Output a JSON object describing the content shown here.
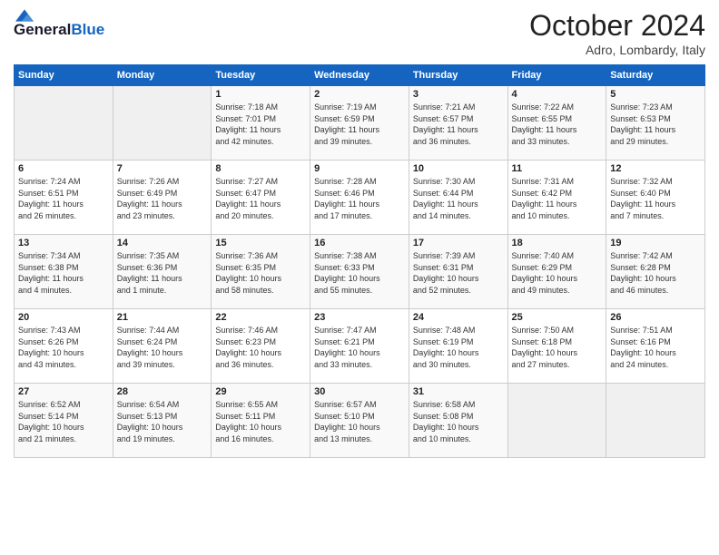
{
  "logo": {
    "general": "General",
    "blue": "Blue"
  },
  "header": {
    "month": "October 2024",
    "location": "Adro, Lombardy, Italy"
  },
  "days_of_week": [
    "Sunday",
    "Monday",
    "Tuesday",
    "Wednesday",
    "Thursday",
    "Friday",
    "Saturday"
  ],
  "weeks": [
    [
      {
        "day": "",
        "info": ""
      },
      {
        "day": "",
        "info": ""
      },
      {
        "day": "1",
        "info": "Sunrise: 7:18 AM\nSunset: 7:01 PM\nDaylight: 11 hours\nand 42 minutes."
      },
      {
        "day": "2",
        "info": "Sunrise: 7:19 AM\nSunset: 6:59 PM\nDaylight: 11 hours\nand 39 minutes."
      },
      {
        "day": "3",
        "info": "Sunrise: 7:21 AM\nSunset: 6:57 PM\nDaylight: 11 hours\nand 36 minutes."
      },
      {
        "day": "4",
        "info": "Sunrise: 7:22 AM\nSunset: 6:55 PM\nDaylight: 11 hours\nand 33 minutes."
      },
      {
        "day": "5",
        "info": "Sunrise: 7:23 AM\nSunset: 6:53 PM\nDaylight: 11 hours\nand 29 minutes."
      }
    ],
    [
      {
        "day": "6",
        "info": "Sunrise: 7:24 AM\nSunset: 6:51 PM\nDaylight: 11 hours\nand 26 minutes."
      },
      {
        "day": "7",
        "info": "Sunrise: 7:26 AM\nSunset: 6:49 PM\nDaylight: 11 hours\nand 23 minutes."
      },
      {
        "day": "8",
        "info": "Sunrise: 7:27 AM\nSunset: 6:47 PM\nDaylight: 11 hours\nand 20 minutes."
      },
      {
        "day": "9",
        "info": "Sunrise: 7:28 AM\nSunset: 6:46 PM\nDaylight: 11 hours\nand 17 minutes."
      },
      {
        "day": "10",
        "info": "Sunrise: 7:30 AM\nSunset: 6:44 PM\nDaylight: 11 hours\nand 14 minutes."
      },
      {
        "day": "11",
        "info": "Sunrise: 7:31 AM\nSunset: 6:42 PM\nDaylight: 11 hours\nand 10 minutes."
      },
      {
        "day": "12",
        "info": "Sunrise: 7:32 AM\nSunset: 6:40 PM\nDaylight: 11 hours\nand 7 minutes."
      }
    ],
    [
      {
        "day": "13",
        "info": "Sunrise: 7:34 AM\nSunset: 6:38 PM\nDaylight: 11 hours\nand 4 minutes."
      },
      {
        "day": "14",
        "info": "Sunrise: 7:35 AM\nSunset: 6:36 PM\nDaylight: 11 hours\nand 1 minute."
      },
      {
        "day": "15",
        "info": "Sunrise: 7:36 AM\nSunset: 6:35 PM\nDaylight: 10 hours\nand 58 minutes."
      },
      {
        "day": "16",
        "info": "Sunrise: 7:38 AM\nSunset: 6:33 PM\nDaylight: 10 hours\nand 55 minutes."
      },
      {
        "day": "17",
        "info": "Sunrise: 7:39 AM\nSunset: 6:31 PM\nDaylight: 10 hours\nand 52 minutes."
      },
      {
        "day": "18",
        "info": "Sunrise: 7:40 AM\nSunset: 6:29 PM\nDaylight: 10 hours\nand 49 minutes."
      },
      {
        "day": "19",
        "info": "Sunrise: 7:42 AM\nSunset: 6:28 PM\nDaylight: 10 hours\nand 46 minutes."
      }
    ],
    [
      {
        "day": "20",
        "info": "Sunrise: 7:43 AM\nSunset: 6:26 PM\nDaylight: 10 hours\nand 43 minutes."
      },
      {
        "day": "21",
        "info": "Sunrise: 7:44 AM\nSunset: 6:24 PM\nDaylight: 10 hours\nand 39 minutes."
      },
      {
        "day": "22",
        "info": "Sunrise: 7:46 AM\nSunset: 6:23 PM\nDaylight: 10 hours\nand 36 minutes."
      },
      {
        "day": "23",
        "info": "Sunrise: 7:47 AM\nSunset: 6:21 PM\nDaylight: 10 hours\nand 33 minutes."
      },
      {
        "day": "24",
        "info": "Sunrise: 7:48 AM\nSunset: 6:19 PM\nDaylight: 10 hours\nand 30 minutes."
      },
      {
        "day": "25",
        "info": "Sunrise: 7:50 AM\nSunset: 6:18 PM\nDaylight: 10 hours\nand 27 minutes."
      },
      {
        "day": "26",
        "info": "Sunrise: 7:51 AM\nSunset: 6:16 PM\nDaylight: 10 hours\nand 24 minutes."
      }
    ],
    [
      {
        "day": "27",
        "info": "Sunrise: 6:52 AM\nSunset: 5:14 PM\nDaylight: 10 hours\nand 21 minutes."
      },
      {
        "day": "28",
        "info": "Sunrise: 6:54 AM\nSunset: 5:13 PM\nDaylight: 10 hours\nand 19 minutes."
      },
      {
        "day": "29",
        "info": "Sunrise: 6:55 AM\nSunset: 5:11 PM\nDaylight: 10 hours\nand 16 minutes."
      },
      {
        "day": "30",
        "info": "Sunrise: 6:57 AM\nSunset: 5:10 PM\nDaylight: 10 hours\nand 13 minutes."
      },
      {
        "day": "31",
        "info": "Sunrise: 6:58 AM\nSunset: 5:08 PM\nDaylight: 10 hours\nand 10 minutes."
      },
      {
        "day": "",
        "info": ""
      },
      {
        "day": "",
        "info": ""
      }
    ]
  ]
}
